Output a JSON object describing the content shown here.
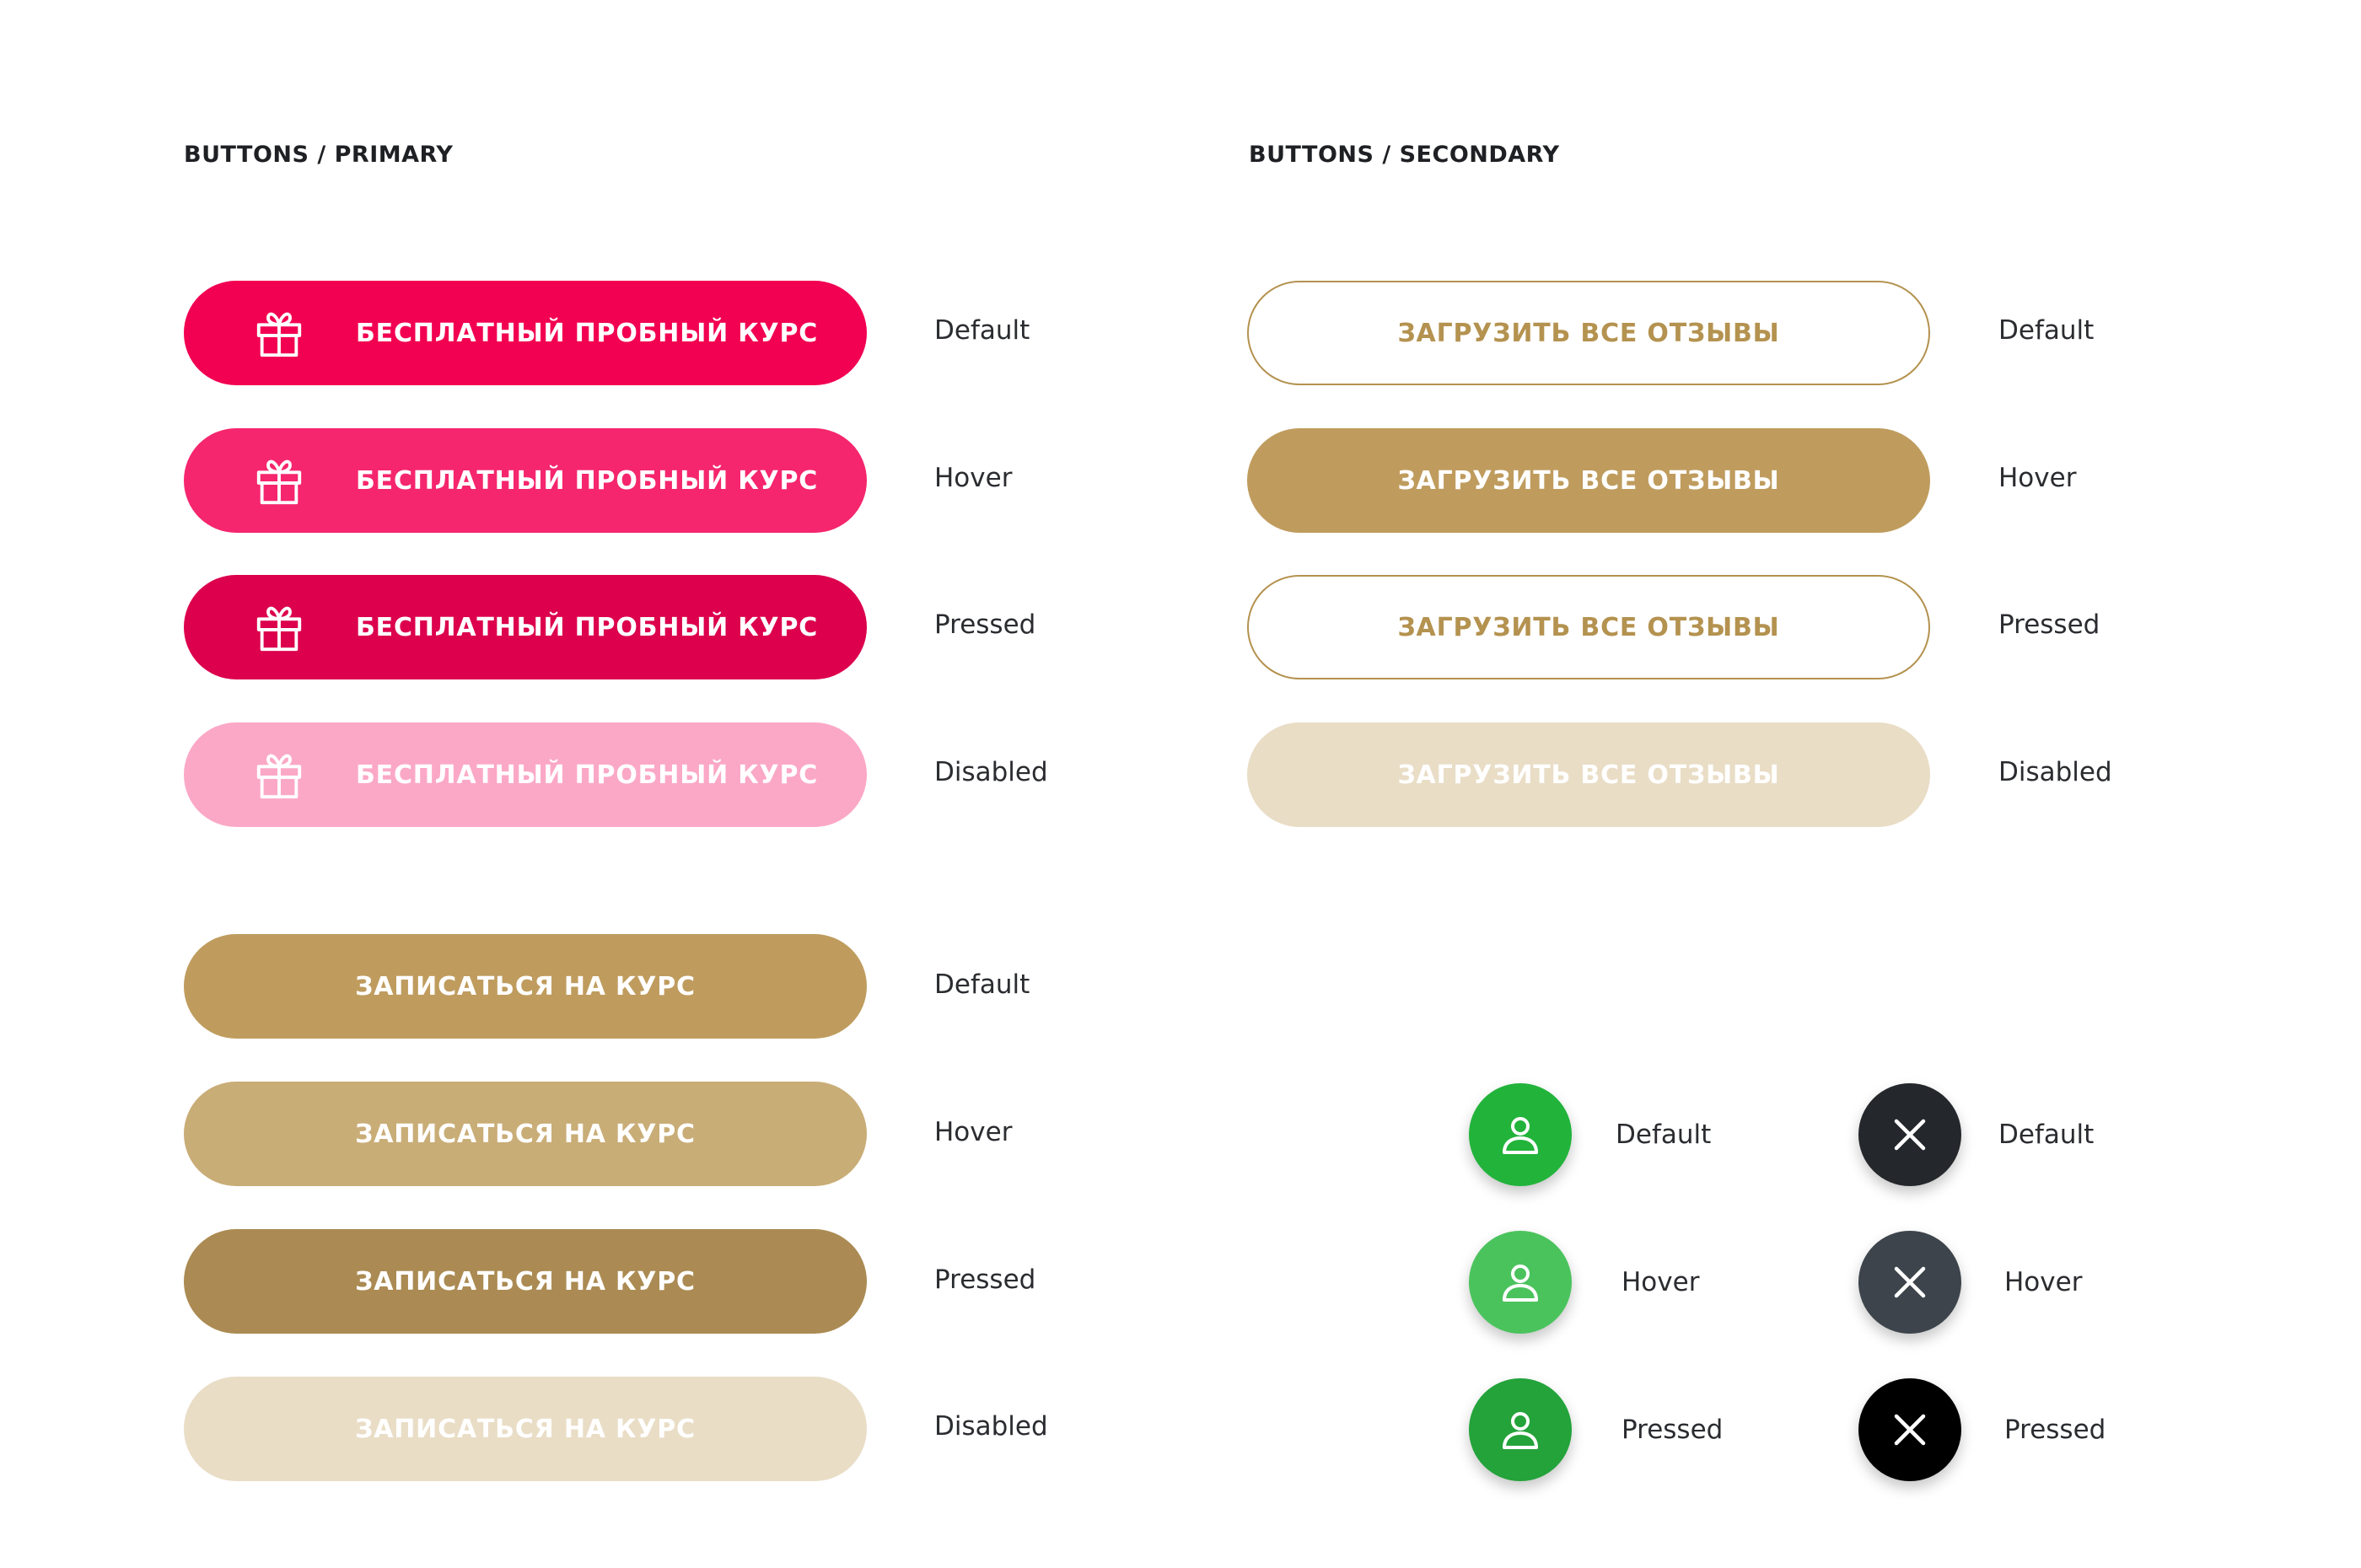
{
  "primary": {
    "title": "BUTTONS / PRIMARY",
    "gift_buttons": [
      {
        "label": "БЕСПЛАТНЫЙ ПРОБНЫЙ КУРС",
        "state": "Default",
        "bg": "#f20051",
        "fg": "#ffffff"
      },
      {
        "label": "БЕСПЛАТНЫЙ ПРОБНЫЙ КУРС",
        "state": "Hover",
        "bg": "#f5266d",
        "fg": "#ffffff"
      },
      {
        "label": "БЕСПЛАТНЫЙ ПРОБНЫЙ КУРС",
        "state": "Pressed",
        "bg": "#dc004d",
        "fg": "#ffffff"
      },
      {
        "label": "БЕСПЛАТНЫЙ ПРОБНЫЙ КУРС",
        "state": "Disabled",
        "bg": "#fba8c6",
        "fg": "#ffffff"
      }
    ],
    "gold_buttons": [
      {
        "label": "ЗАПИСАТЬСЯ НА КУРС",
        "state": "Default",
        "bg": "#bf9c5e",
        "fg": "#ffffff"
      },
      {
        "label": "ЗАПИСАТЬСЯ НА КУРС",
        "state": "Hover",
        "bg": "#c9ad77",
        "fg": "#ffffff"
      },
      {
        "label": "ЗАПИСАТЬСЯ НА КУРС",
        "state": "Pressed",
        "bg": "#ab8b53",
        "fg": "#ffffff"
      },
      {
        "label": "ЗАПИСАТЬСЯ НА КУРС",
        "state": "Disabled",
        "bg": "#e9ddc6",
        "fg": "#ffffff"
      }
    ]
  },
  "secondary": {
    "title": "BUTTONS / SECONDARY",
    "buttons": [
      {
        "label": "ЗАГРУЗИТЬ ВСЕ ОТЗЫВЫ",
        "state": "Default",
        "bg": "#ffffff",
        "fg": "#b4924f",
        "border": "#b4924f"
      },
      {
        "label": "ЗАГРУЗИТЬ ВСЕ ОТЗЫВЫ",
        "state": "Hover",
        "bg": "#bf9c5e",
        "fg": "#ffffff",
        "border": "#bf9c5e"
      },
      {
        "label": "ЗАГРУЗИТЬ ВСЕ ОТЗЫВЫ",
        "state": "Pressed",
        "bg": "#ffffff",
        "fg": "#b4924f",
        "border": "#b4924f"
      },
      {
        "label": "ЗАГРУЗИТЬ ВСЕ ОТЗЫВЫ",
        "state": "Disabled",
        "bg": "#e9ddc6",
        "fg": "#ffffff",
        "border": "#e9ddc6"
      }
    ],
    "user_buttons": [
      {
        "state": "Default",
        "bg": "#22b33b",
        "icon": "user-icon"
      },
      {
        "state": "Hover",
        "bg": "#4bc35d",
        "icon": "user-icon"
      },
      {
        "state": "Pressed",
        "bg": "#23a33a",
        "icon": "user-icon"
      }
    ],
    "close_buttons": [
      {
        "state": "Default",
        "bg": "#24272b",
        "icon": "close-icon"
      },
      {
        "state": "Hover",
        "bg": "#3d444b",
        "icon": "close-icon"
      },
      {
        "state": "Pressed",
        "bg": "#000000",
        "icon": "close-icon"
      }
    ]
  }
}
